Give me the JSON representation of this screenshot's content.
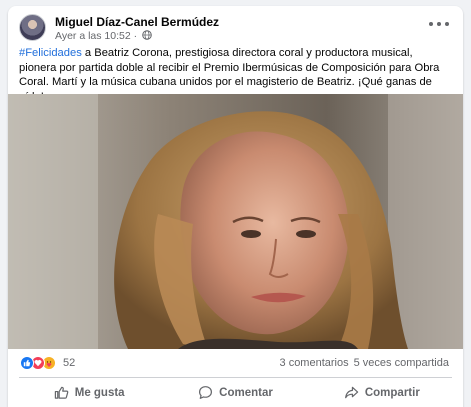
{
  "post": {
    "author": "Miguel Díaz-Canel Bermúdez",
    "timestamp": "Ayer a las 10:52",
    "separator": " · ",
    "privacy_icon": "globe-icon",
    "hashtag": "#Felicidades",
    "body": " a Beatriz Corona, prestigiosa directora coral y productora musical, pionera por partida doble al recibir el Premio Ibermúsicas de Composición para Obra Coral. Martí y la música cubana unidos por el magisterio de Beatriz. ¡Qué ganas de oírlo!",
    "image_alt": "Photo of a woman with wavy hair",
    "reaction_icons": [
      "like-icon",
      "love-icon",
      "care-icon"
    ],
    "reaction_count": "52",
    "comments": "3 comentarios",
    "shares": "5 veces compartida",
    "actions": {
      "like": "Me gusta",
      "comment": "Comentar",
      "share": "Compartir"
    }
  },
  "colors": {
    "hashtag": "#216fdb",
    "secondary_text": "#65676b",
    "like_blue": "#1877f2",
    "love_red": "#f33e58",
    "care_yellow": "#f7b125"
  }
}
